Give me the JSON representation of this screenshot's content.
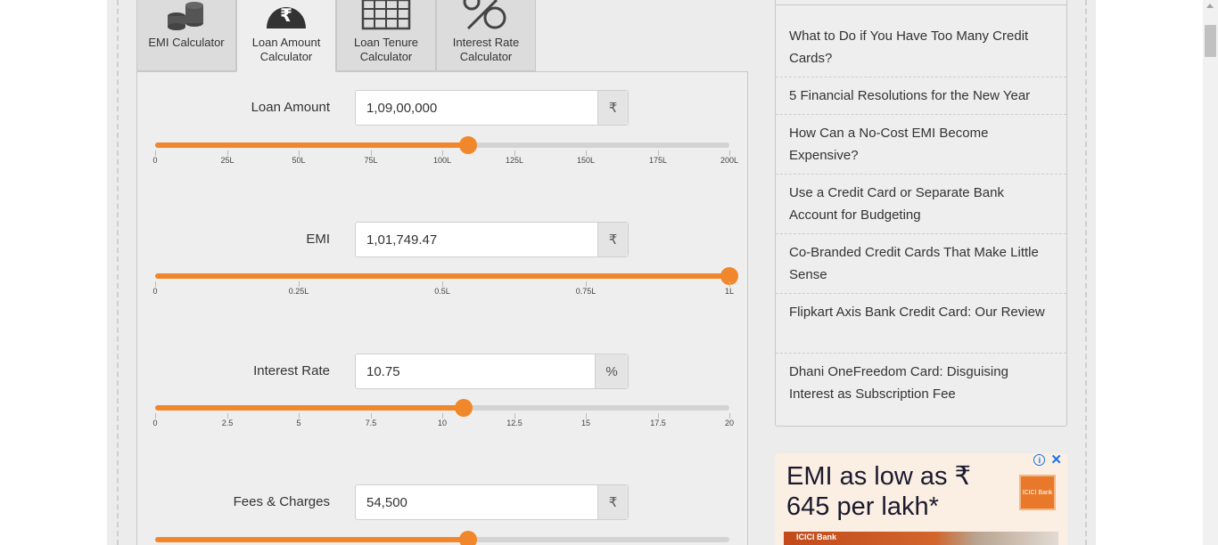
{
  "tabs": [
    {
      "label": "EMI Calculator",
      "icon": "coins-stack-icon",
      "active": false
    },
    {
      "label": "Loan Amount Calculator",
      "icon": "money-bag-icon",
      "active": true
    },
    {
      "label": "Loan Tenure Calculator",
      "icon": "calendar-icon",
      "active": false
    },
    {
      "label": "Interest Rate Calculator",
      "icon": "percent-icon",
      "active": false
    }
  ],
  "fields": {
    "loan_amount": {
      "label": "Loan Amount",
      "value": "1,09,00,000",
      "unit": "₹",
      "slider_fraction": 0.545,
      "ticks": [
        "0",
        "25L",
        "50L",
        "75L",
        "100L",
        "125L",
        "150L",
        "175L",
        "200L"
      ]
    },
    "emi": {
      "label": "EMI",
      "value": "1,01,749.47",
      "unit": "₹",
      "slider_fraction": 1.0,
      "ticks": [
        "0",
        "0.25L",
        "0.5L",
        "0.75L",
        "1L"
      ]
    },
    "interest_rate": {
      "label": "Interest Rate",
      "value": "10.75",
      "unit": "%",
      "slider_fraction": 0.5375,
      "ticks": [
        "0",
        "2.5",
        "5",
        "7.5",
        "10",
        "12.5",
        "15",
        "17.5",
        "20"
      ]
    },
    "fees_charges": {
      "label": "Fees & Charges",
      "value": "54,500",
      "unit": "₹",
      "slider_fraction": 0.545
    }
  },
  "sidebar": {
    "items": [
      "What to Do if You Have Too Many Credit Cards?",
      "5 Financial Resolutions for the New Year",
      "How Can a No-Cost EMI Become Expensive?",
      "Use a Credit Card or Separate Bank Account for Budgeting",
      "Co-Branded Credit Cards That Make Little Sense",
      "Flipkart Axis Bank Credit Card: Our Review",
      "Dhani OneFreedom Card: Disguising Interest as Subscription Fee"
    ]
  },
  "ad": {
    "headline": "EMI as low as ₹ 645 per lakh*",
    "logo_text": "ICICI Bank",
    "banner_text": "ICICI Bank",
    "info_glyph": "i",
    "close_glyph": "✕"
  },
  "colors": {
    "accent": "#f0882b",
    "track": "#d3d3d3",
    "panel": "#eeeeee"
  }
}
